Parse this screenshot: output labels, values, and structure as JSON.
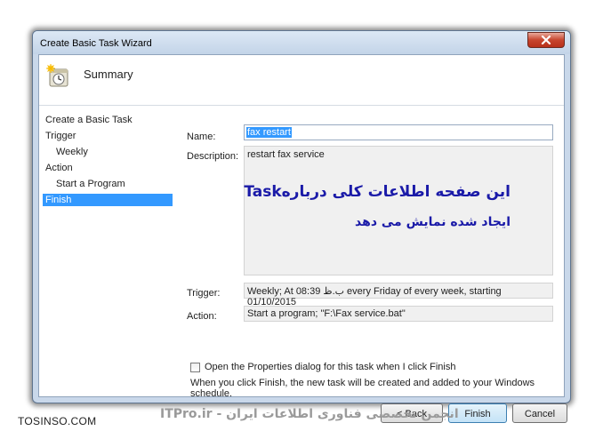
{
  "window": {
    "title": "Create Basic Task Wizard"
  },
  "header": {
    "title": "Summary",
    "icon": "task-clock-icon"
  },
  "nav": {
    "items": [
      {
        "label": "Create a Basic Task",
        "sub": false,
        "selected": false
      },
      {
        "label": "Trigger",
        "sub": false,
        "selected": false
      },
      {
        "label": "Weekly",
        "sub": true,
        "selected": false
      },
      {
        "label": "Action",
        "sub": false,
        "selected": false
      },
      {
        "label": "Start a Program",
        "sub": true,
        "selected": false
      },
      {
        "label": "Finish",
        "sub": false,
        "selected": true
      }
    ]
  },
  "form": {
    "name_label": "Name:",
    "name_value": "fax restart",
    "description_label": "Description:",
    "description_value": "restart fax service",
    "annotation_line1": "این صفحه اطلاعات کلی دربارهTask",
    "annotation_line2": "ایجاد شده نمایش می دهد",
    "trigger_label": "Trigger:",
    "trigger_value": "Weekly; At 08:39 ب.ظ every Friday of every week, starting 01/10/2015",
    "action_label": "Action:",
    "action_value": "Start a program; \"F:\\Fax service.bat\"",
    "checkbox_label": "Open the Properties dialog for this task when I click Finish",
    "checkbox_checked": false,
    "info_text": "When you click Finish, the new task will be created and added to your Windows schedule."
  },
  "buttons": {
    "back": "< Back",
    "finish": "Finish",
    "cancel": "Cancel"
  },
  "watermark": {
    "left": "TOSINSO.COM",
    "right": "انجمن تخصصی فناوری اطلاعات ایران - ITPro.ir"
  },
  "colors": {
    "selection": "#3399ff",
    "annotation": "#1a1aa8",
    "close_button": "#c7452e"
  }
}
